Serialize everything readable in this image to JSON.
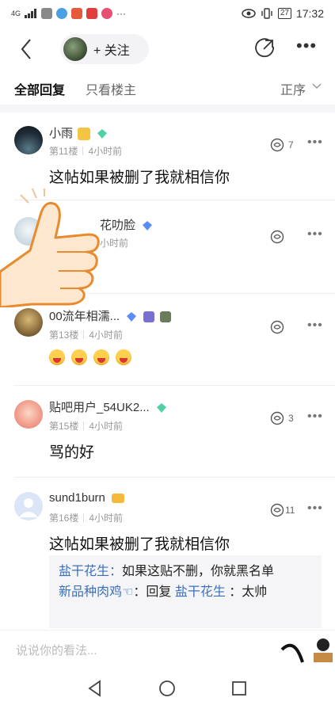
{
  "status_bar": {
    "network": "4G",
    "time": "17:32",
    "battery": "27"
  },
  "header": {
    "follow_label": "+ 关注"
  },
  "tabs": {
    "all": "全部回复",
    "op_only": "只看楼主",
    "sort": "正序"
  },
  "replies": [
    {
      "user": "小雨",
      "floor": "第11楼",
      "time": "4小时前",
      "likes": "7",
      "text": "这帖如果被删了我就相信你"
    },
    {
      "user": "花叻脸",
      "floor": "",
      "time": "小时前",
      "likes": "",
      "text": ""
    },
    {
      "user": "00流年相濡...",
      "floor": "第13楼",
      "time": "4小时前",
      "likes": "",
      "text": ""
    },
    {
      "user": "贴吧用户_54UK2...",
      "floor": "第15楼",
      "time": "4小时前",
      "likes": "3",
      "text": "骂的好"
    },
    {
      "user": "sund1burn",
      "floor": "第16楼",
      "time": "4小时前",
      "likes": "11",
      "text": "这帖如果被删了我就相信你"
    }
  ],
  "quote": {
    "line1_user": "盐干花生：",
    "line1_text": "如果这贴不删，你就黑名单",
    "line2_user": "新品种肉鸡",
    "line2_mid": "：回复",
    "line2_mention": "盐干花生",
    "line2_text": "：太帅"
  },
  "input": {
    "placeholder": "说说你的看法..."
  },
  "colors": {
    "accent_blue": "#3a6fbf",
    "gem_green": "#4fd1a5",
    "gem_blue": "#5b8def"
  }
}
